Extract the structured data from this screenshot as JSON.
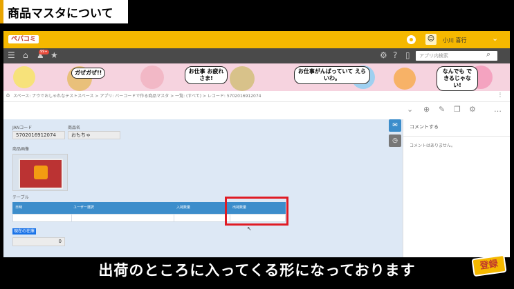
{
  "caption_title": "商品マスタについて",
  "header": {
    "logo_text": "ペパコミ",
    "user_name": "小川 喜行",
    "search_placeholder": "アプリ内検索"
  },
  "toolbar": {
    "notification_badge": "99+"
  },
  "banner": {
    "bubbles": [
      "ガぜガぜ!!",
      "お仕事 お疲れさま!",
      "お仕事がんばっていて えらいわ。",
      "なんでも できるじゃない!"
    ]
  },
  "breadcrumb": {
    "items": [
      "スペース: ナウでおしゃれなテストスペース",
      "アプリ: バーコードで作る商品マスタ",
      "一覧: (すべて)",
      "レコード: 5702016912074"
    ]
  },
  "record": {
    "jan_label": "JANコード",
    "jan_value": "5702016912074",
    "name_label": "商品名",
    "name_value": "おもちゃ",
    "image_label": "商品画像",
    "table_label": "テーブル",
    "table_columns": [
      "日時",
      "ユーザー選択",
      "入荷数量",
      "出荷数量"
    ],
    "stock_label": "現在の在庫",
    "stock_value": "0"
  },
  "comments": {
    "title": "コメントする",
    "empty_text": "コメントはありません。"
  },
  "subtitle": "出荷のところに入ってくる形になっております",
  "sticker_text": "登録",
  "colors": {
    "header": "#f5b800",
    "table_header": "#3c8dcb",
    "highlight": "#e01b24"
  }
}
